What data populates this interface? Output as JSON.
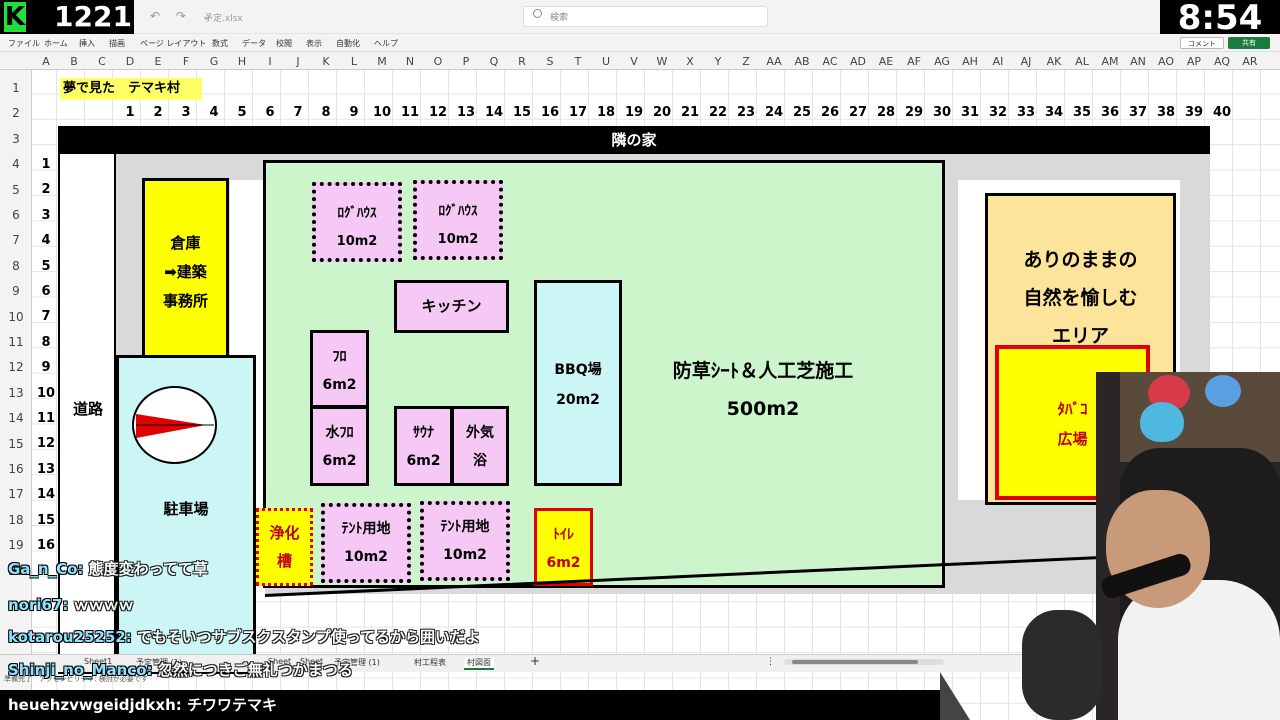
{
  "stream": {
    "count": "1221",
    "clock": "8:54",
    "file_name": "予定.xlsx",
    "search_placeholder": "検索"
  },
  "ribbon": {
    "menus": [
      "ファイル",
      "ホーム",
      "挿入",
      "描画",
      "ページ レイアウト",
      "数式",
      "データ",
      "校閲",
      "表示",
      "自動化",
      "ヘルプ"
    ],
    "comment_label": "コメント",
    "share_label": "共有"
  },
  "grid": {
    "columns": [
      "A",
      "B",
      "C",
      "D",
      "E",
      "F",
      "G",
      "H",
      "I",
      "J",
      "K",
      "L",
      "M",
      "N",
      "O",
      "P",
      "Q",
      "R",
      "S",
      "T",
      "U",
      "V",
      "W",
      "X",
      "Y",
      "Z",
      "AA",
      "AB",
      "AC",
      "AD",
      "AE",
      "AF",
      "AG",
      "AH",
      "AI",
      "AJ",
      "AK",
      "AL",
      "AM",
      "AN",
      "AO",
      "AP",
      "AQ",
      "AR"
    ],
    "rows": [
      "1",
      "2",
      "3",
      "4",
      "5",
      "6",
      "7",
      "8",
      "9",
      "10",
      "11",
      "12",
      "13",
      "14",
      "15",
      "16",
      "17",
      "18",
      "19",
      "20"
    ],
    "title_cell": "夢で見た　テマキ村",
    "header_numbers": [
      "1",
      "2",
      "3",
      "4",
      "5",
      "6",
      "7",
      "8",
      "9",
      "10",
      "11",
      "12",
      "13",
      "14",
      "15",
      "16",
      "17",
      "18",
      "19",
      "20",
      "21",
      "22",
      "23",
      "24",
      "25",
      "26",
      "27",
      "28",
      "29",
      "30",
      "31",
      "32",
      "33",
      "34",
      "35",
      "36",
      "37",
      "38",
      "39",
      "40"
    ],
    "left_numbers": [
      "1",
      "2",
      "3",
      "4",
      "5",
      "6",
      "7",
      "8",
      "9",
      "10",
      "11",
      "12",
      "13",
      "14",
      "15",
      "16"
    ]
  },
  "map": {
    "neighbor": "隣の家",
    "road": "道路",
    "warehouse": [
      "倉庫",
      "➡建築",
      "事務所"
    ],
    "parking": "駐車場",
    "field": [
      "防草ｼｰﾄ＆人工芝施工",
      "500m2"
    ],
    "log_house_1": [
      "ﾛｸﾞﾊｳｽ",
      "10m2"
    ],
    "log_house_2": [
      "ﾛｸﾞﾊｳｽ",
      "10m2"
    ],
    "kitchen": "キッチン",
    "bbq": [
      "BBQ場",
      "20m2"
    ],
    "bath": [
      "ﾌﾛ",
      "6m2"
    ],
    "cold_bath": [
      "水ﾌﾛ",
      "6m2"
    ],
    "sauna": [
      "ｻｳﾅ",
      "6m2"
    ],
    "outdoor_bath": [
      "外気",
      "浴"
    ],
    "septic": [
      "浄化",
      "槽"
    ],
    "tent_1": [
      "ﾃﾝﾄ用地",
      "10m2"
    ],
    "tent_2": [
      "ﾃﾝﾄ用地",
      "10m2"
    ],
    "toilet": [
      "ﾄｲﾚ",
      "6m2"
    ],
    "nature_area": [
      "ありのままの",
      "自然を愉しむ",
      "エリア"
    ],
    "smoking_area": [
      "ﾀﾊﾞｺ",
      "広場"
    ]
  },
  "sheet_tabs": [
    "Sheet1",
    "予定管理 (1)",
    "Sheet",
    "Sheet",
    "予定管理 (1)",
    "村工程表",
    "村図面"
  ],
  "status_text": "準備完了　アクセシビリティ: 検討が必要です",
  "chat": [
    {
      "user": "Ga_n_Co:",
      "message": "態度変わってて草"
    },
    {
      "user": "nori67:",
      "message": "ｗｗｗｗ"
    },
    {
      "user": "kotarou25252:",
      "message": "でもそいつサブスクスタンプ使ってるから囲いだよ"
    },
    {
      "user": "Shinji_no_Manco:",
      "message": "忽然につきご無礼つかまつる"
    },
    {
      "user": "heuehzvwgeidjdkxh:",
      "message": "チワワテマキ"
    }
  ]
}
